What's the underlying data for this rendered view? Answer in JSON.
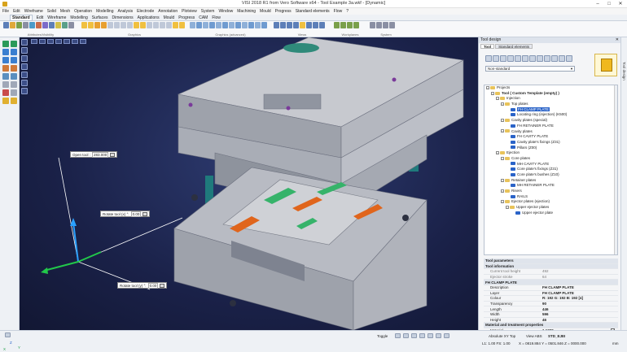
{
  "window": {
    "title": "VISI 2018 R1  from Vero Software x64 - Tool Example 3a.wkf - [Dynamic]",
    "minimize": "–",
    "maximize": "□",
    "close": "✕"
  },
  "menu": [
    "File",
    "Edit",
    "Wireframe",
    "Solid",
    "Mesh",
    "Operation",
    "Modelling",
    "Analysis",
    "Electrode",
    "Annotation",
    "Plotview",
    "System",
    "Window",
    "Machining",
    "Mould",
    "Progress",
    "Standard elements",
    "Flow",
    "?"
  ],
  "tabs": [
    "Standard",
    "Edit",
    "Wireframe",
    "Modelling",
    "Surfaces",
    "Dimensions",
    "Applications",
    "Mould",
    "Progress",
    "CAM",
    "Flow"
  ],
  "ribbon_groups": [
    "Attributes/Visibility",
    "Graphics",
    "Graphics (advanced)",
    "Views",
    "Workplanes",
    "System"
  ],
  "viewport": {
    "callouts": [
      {
        "label": "Open tool :",
        "value": "283.000"
      },
      {
        "label": "Rotate tool (x) °:",
        "value": "0.00"
      },
      {
        "label": "Rotate tool (y) °:",
        "value": "0.00"
      }
    ]
  },
  "panel": {
    "title": "Tool design",
    "close": "✕",
    "tabs": [
      "Tool",
      "Standard elements"
    ],
    "dropdown": "Non-standard",
    "tree": [
      {
        "label": "Projects",
        "level": 0,
        "exp": "−",
        "color": "#e8c35a"
      },
      {
        "label": "Tool ( Custom Template (empty) )",
        "level": 1,
        "exp": "−",
        "color": "#e8c35a",
        "bold": true
      },
      {
        "label": "Injection",
        "level": 2,
        "exp": "−",
        "color": "#e8c35a"
      },
      {
        "label": "Top plates",
        "level": 3,
        "exp": "−",
        "color": "#e8c35a"
      },
      {
        "label": "FH CLAMP PLATE",
        "level": 4,
        "exp": "",
        "color": "#2a63c8",
        "selected": true
      },
      {
        "label": "Locating ring (injection) (K500)",
        "level": 4,
        "exp": "",
        "color": "#2a63c8"
      },
      {
        "label": "Cavity plates (special)",
        "level": 3,
        "exp": "−",
        "color": "#e8c35a"
      },
      {
        "label": "FH RETAINER PLATE",
        "level": 4,
        "exp": "",
        "color": "#2a63c8"
      },
      {
        "label": "Cavity plates",
        "level": 3,
        "exp": "−",
        "color": "#e8c35a"
      },
      {
        "label": "FH CAVITY PLATE",
        "level": 4,
        "exp": "",
        "color": "#2a63c8"
      },
      {
        "label": "Cavity plate's fixings (Z31)",
        "level": 4,
        "exp": "",
        "color": "#2a63c8"
      },
      {
        "label": "Pillars (Z00)",
        "level": 4,
        "exp": "",
        "color": "#2a63c8"
      },
      {
        "label": "Ejection",
        "level": 2,
        "exp": "−",
        "color": "#e8c35a"
      },
      {
        "label": "Core plates",
        "level": 3,
        "exp": "−",
        "color": "#e8c35a"
      },
      {
        "label": "MH CAVITY PLATE",
        "level": 4,
        "exp": "",
        "color": "#2a63c8"
      },
      {
        "label": "Core plate's fixings (Z31)",
        "level": 4,
        "exp": "",
        "color": "#2a63c8"
      },
      {
        "label": "Core plate's bushes (Z10)",
        "level": 4,
        "exp": "",
        "color": "#2a63c8"
      },
      {
        "label": "Retainer plates",
        "level": 3,
        "exp": "−",
        "color": "#e8c35a"
      },
      {
        "label": "MH RETAINER PLATE",
        "level": 4,
        "exp": "",
        "color": "#2a63c8"
      },
      {
        "label": "Risers",
        "level": 3,
        "exp": "−",
        "color": "#e8c35a"
      },
      {
        "label": "RAILS",
        "level": 4,
        "exp": "",
        "color": "#2a63c8"
      },
      {
        "label": "Ejector plates (ejection)",
        "level": 3,
        "exp": "−",
        "color": "#e8c35a"
      },
      {
        "label": "Upper ejector plates",
        "level": 4,
        "exp": "−",
        "color": "#e8c35a"
      },
      {
        "label": "Upper ejector plate",
        "level": 5,
        "exp": "",
        "color": "#2a63c8"
      }
    ],
    "props": [
      {
        "type": "sec",
        "k": "Tool parameters",
        "v": ""
      },
      {
        "type": "sec",
        "k": "Tool information",
        "v": ""
      },
      {
        "type": "dis",
        "k": "Current tool height",
        "v": "492"
      },
      {
        "type": "dis",
        "k": "Ejector stroke",
        "v": "64"
      },
      {
        "type": "sec",
        "k": "FH CLAMP PLATE",
        "v": ""
      },
      {
        "type": "row",
        "k": "Description",
        "v": "FH CLAMP PLATE"
      },
      {
        "type": "row",
        "k": "Layer",
        "v": "FH CLAMP PLATE"
      },
      {
        "type": "row",
        "k": "Colour",
        "v": "R: 192 G: 192 B: 192 [4]"
      },
      {
        "type": "row",
        "k": "Transparency",
        "v": "90"
      },
      {
        "type": "row",
        "k": "Length",
        "v": "446"
      },
      {
        "type": "row",
        "k": "Width",
        "v": "596"
      },
      {
        "type": "row",
        "k": "Height",
        "v": "46"
      },
      {
        "type": "sec",
        "k": "Material and treatment properties",
        "v": ""
      },
      {
        "type": "chk",
        "k": "Material",
        "v": "1.1730"
      },
      {
        "type": "chk",
        "k": "Treatment",
        "v": "Standard"
      }
    ]
  },
  "right_sidebar": "Tool design",
  "status": {
    "toggle": "Toggle",
    "absolute": "Absolute XY Top",
    "view": "View ABS",
    "std": "STD_EJEI",
    "scale": "L1: 1.00  FS: 1.00",
    "coords": "X = 0819.884 Y = 0501.846 Z = 0000.000",
    "unit": "mm",
    "axis_z": "Z",
    "axis_x": "X",
    "axis_y": "Y"
  },
  "colors": {
    "accent": "#2a63c8",
    "viewport_bg": "#1a2148",
    "panel_bg": "#f4f5f7"
  }
}
